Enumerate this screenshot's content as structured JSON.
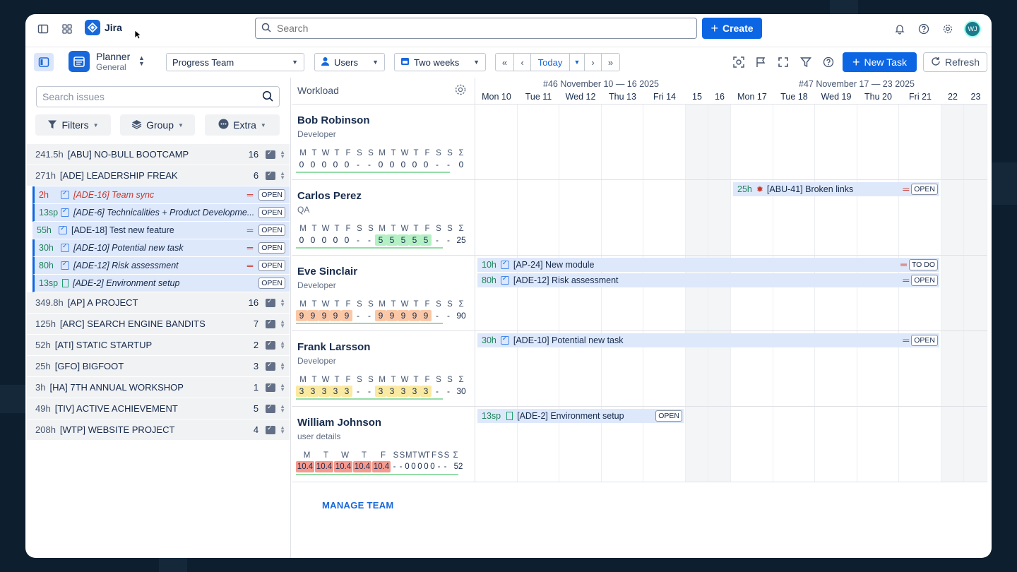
{
  "app": {
    "name": "Jira"
  },
  "search": {
    "placeholder": "Search"
  },
  "create_label": "Create",
  "avatar_initials": "WJ",
  "planner": {
    "title": "Planner",
    "subtitle": "General"
  },
  "toolbar": {
    "team": "Progress Team",
    "users": "Users",
    "period": "Two weeks",
    "today": "Today",
    "new_task": "New Task",
    "refresh": "Refresh"
  },
  "left": {
    "search_placeholder": "Search issues",
    "filters": "Filters",
    "group": "Group",
    "extra": "Extra",
    "projects": [
      {
        "hours": "241.5h",
        "name": "[ABU] NO-BULL BOOTCAMP",
        "count": "16"
      },
      {
        "hours": "271h",
        "name": "[ADE] LEADERSHIP FREAK",
        "count": "6"
      },
      {
        "hours": "349.8h",
        "name": "[AP] A PROJECT",
        "count": "16"
      },
      {
        "hours": "125h",
        "name": "[ARC] SEARCH ENGINE BANDITS",
        "count": "7"
      },
      {
        "hours": "52h",
        "name": "[ATI] STATIC STARTUP",
        "count": "2"
      },
      {
        "hours": "25h",
        "name": "[GFO] BIGFOOT",
        "count": "3"
      },
      {
        "hours": "3h",
        "name": "[HA] 7TH ANNUAL WORKSHOP",
        "count": "1"
      },
      {
        "hours": "49h",
        "name": "[TIV] ACTIVE ACHIEVEMENT",
        "count": "5"
      },
      {
        "hours": "208h",
        "name": "[WTP] WEBSITE PROJECT",
        "count": "4"
      }
    ],
    "issues": [
      {
        "est": "2h",
        "name": "[ADE-16] Team sync",
        "status": "OPEN"
      },
      {
        "est": "13sp",
        "name": "[ADE-6] Technicalities + Product Developme...",
        "status": "OPEN"
      },
      {
        "est": "55h",
        "name": "[ADE-18] Test new feature",
        "status": "OPEN"
      },
      {
        "est": "30h",
        "name": "[ADE-10] Potential new task",
        "status": "OPEN"
      },
      {
        "est": "80h",
        "name": "[ADE-12] Risk assessment",
        "status": "OPEN"
      },
      {
        "est": "13sp",
        "name": "[ADE-2] Environment setup",
        "status": "OPEN"
      }
    ]
  },
  "workload": {
    "title": "Workload",
    "weeks": [
      "#46 November 10 — 16 2025",
      "#47 November 17 — 23 2025"
    ],
    "days": [
      "Mon 10",
      "Tue 11",
      "Wed 12",
      "Thu 13",
      "Fri 14",
      "15",
      "16",
      "Mon 17",
      "Tue 18",
      "Wed 19",
      "Thu 20",
      "Fri 21",
      "22",
      "23"
    ],
    "day_letters": [
      "M",
      "T",
      "W",
      "T",
      "F",
      "S",
      "S",
      "M",
      "T",
      "W",
      "T",
      "F",
      "S",
      "S",
      "Σ"
    ],
    "people": [
      {
        "name": "Bob Robinson",
        "role": "Developer",
        "values": [
          "0",
          "0",
          "0",
          "0",
          "0",
          "-",
          "-",
          "0",
          "0",
          "0",
          "0",
          "0",
          "-",
          "-",
          "0"
        ]
      },
      {
        "name": "Carlos Perez",
        "role": "QA",
        "values": [
          "0",
          "0",
          "0",
          "0",
          "0",
          "-",
          "-",
          "5",
          "5",
          "5",
          "5",
          "5",
          "-",
          "-",
          "25"
        ]
      },
      {
        "name": "Eve Sinclair",
        "role": "Developer",
        "values": [
          "9",
          "9",
          "9",
          "9",
          "9",
          "-",
          "-",
          "9",
          "9",
          "9",
          "9",
          "9",
          "-",
          "-",
          "90"
        ]
      },
      {
        "name": "Frank Larsson",
        "role": "Developer",
        "values": [
          "3",
          "3",
          "3",
          "3",
          "3",
          "-",
          "-",
          "3",
          "3",
          "3",
          "3",
          "3",
          "-",
          "-",
          "30"
        ]
      },
      {
        "name": "William Johnson",
        "role": "user details",
        "values": [
          "10.4",
          "10.4",
          "10.4",
          "10.4",
          "10.4",
          "-",
          "-",
          "0",
          "0",
          "0",
          "0",
          "0",
          "-",
          "-",
          "52"
        ]
      }
    ],
    "tasks": [
      {
        "est": "25h",
        "name": "[ABU-41] Broken links",
        "status": "OPEN"
      },
      {
        "est": "10h",
        "name": "[AP-24] New module",
        "status": "TO DO"
      },
      {
        "est": "80h",
        "name": "[ADE-12] Risk assessment",
        "status": "OPEN"
      },
      {
        "est": "30h",
        "name": "[ADE-10] Potential new task",
        "status": "OPEN"
      },
      {
        "est": "13sp",
        "name": "[ADE-2] Environment setup",
        "status": "OPEN"
      }
    ],
    "manage_team": "MANAGE TEAM"
  }
}
